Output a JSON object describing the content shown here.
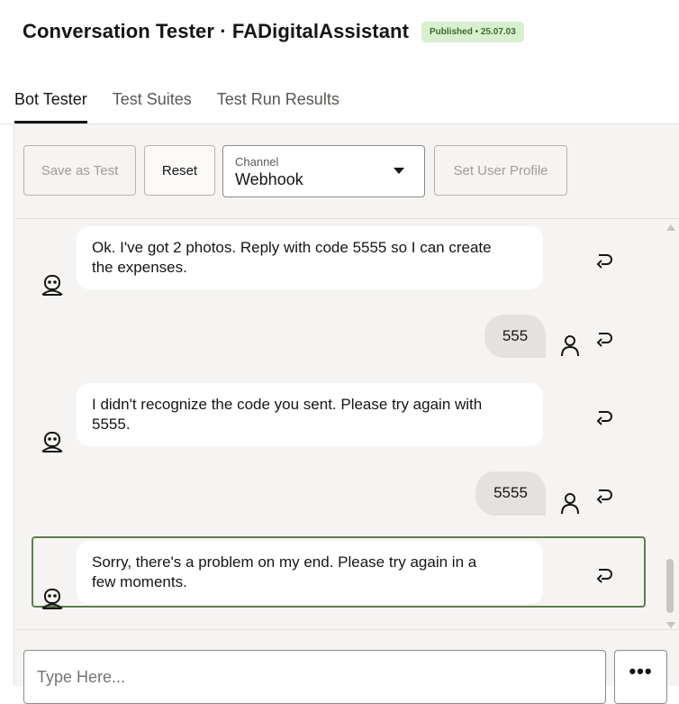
{
  "header": {
    "title": "Conversation Tester · FADigitalAssistant",
    "badge": "Published • 25.07.03"
  },
  "tabs": [
    {
      "label": "Bot Tester",
      "active": true
    },
    {
      "label": "Test Suites",
      "active": false
    },
    {
      "label": "Test Run Results",
      "active": false
    }
  ],
  "toolbar": {
    "save_as_test": "Save as Test",
    "reset": "Reset",
    "channel_label": "Channel",
    "channel_value": "Webhook",
    "set_user_profile": "Set User Profile"
  },
  "messages": [
    {
      "from": "bot",
      "lines": [
        "Ok. I've got 2 photos. Reply with code 5555 so I can create",
        "the expenses."
      ]
    },
    {
      "from": "user",
      "text": "555"
    },
    {
      "from": "bot",
      "lines": [
        "I didn't recognize the code you sent. Please try again with",
        "5555."
      ]
    },
    {
      "from": "user",
      "text": "5555"
    },
    {
      "from": "bot",
      "lines": [
        "Sorry, there's a problem on my end. Please try again in a",
        "few moments."
      ],
      "selected": true
    }
  ],
  "composer": {
    "placeholder": "Type Here...",
    "more_label": "•••"
  },
  "colors": {
    "badge_bg": "#d8f0cf",
    "badge_text": "#3f6a2a",
    "selected_border": "#5f7d4f",
    "panel_bg": "#f5f4f2"
  },
  "icons": {
    "bot": "robot-icon",
    "user": "user-icon",
    "reply": "reply-icon"
  }
}
